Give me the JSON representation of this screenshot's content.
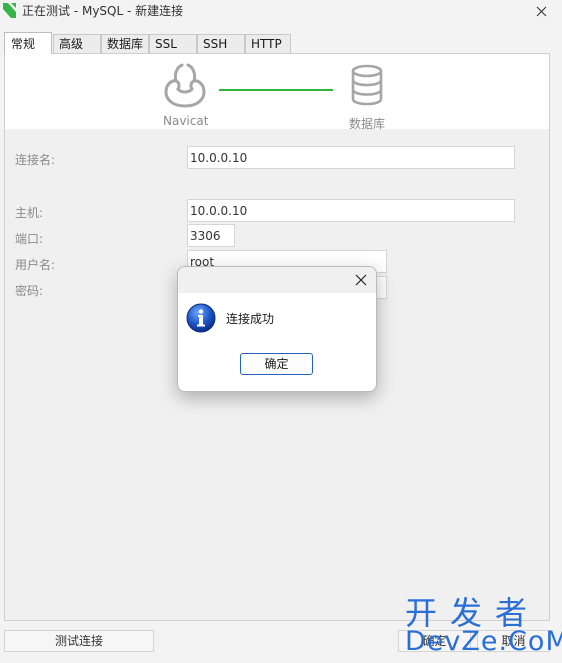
{
  "window": {
    "title": "正在测试 - MySQL - 新建连接",
    "accent": "#32b53c"
  },
  "tabs": [
    {
      "label": "常规",
      "active": true
    },
    {
      "label": "高级",
      "active": false
    },
    {
      "label": "数据库",
      "active": false
    },
    {
      "label": "SSL",
      "active": false
    },
    {
      "label": "SSH",
      "active": false
    },
    {
      "label": "HTTP",
      "active": false
    }
  ],
  "header": {
    "left_label": "Navicat",
    "right_label": "数据库",
    "left_icon": "navicat-logo-icon",
    "right_icon": "database-icon"
  },
  "form": {
    "connection_name": {
      "label": "连接名:",
      "value": "10.0.0.10"
    },
    "host": {
      "label": "主机:",
      "value": "10.0.0.10"
    },
    "port": {
      "label": "端口:",
      "value": "3306"
    },
    "username": {
      "label": "用户名:",
      "value": "root"
    },
    "password": {
      "label": "密码:",
      "value": ""
    }
  },
  "footer": {
    "test_button": "测试连接",
    "ok_button": "确定",
    "cancel_button": "取消"
  },
  "dialog": {
    "message": "连接成功",
    "ok_button": "确定",
    "icon": "info-icon",
    "close_icon": "close-icon"
  },
  "watermark": {
    "line1": "开发者",
    "line2": "DevZe.CoM"
  }
}
